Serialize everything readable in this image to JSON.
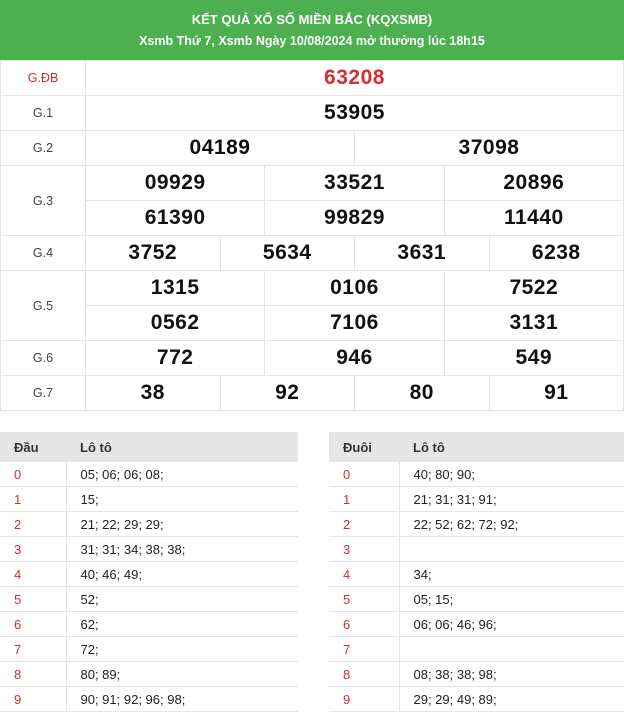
{
  "header": {
    "title": "KẾT QUẢ XỔ SỐ MIỀN BẮC (KQXSMB)",
    "subtitle": "Xsmb Thứ 7, Xsmb Ngày 10/08/2024 mở thưởng lúc 18h15"
  },
  "prizes": {
    "gdb": {
      "label": "G.ĐB",
      "values": [
        "63208"
      ]
    },
    "g1": {
      "label": "G.1",
      "values": [
        "53905"
      ]
    },
    "g2": {
      "label": "G.2",
      "values": [
        "04189",
        "37098"
      ]
    },
    "g3": {
      "label": "G.3",
      "values": [
        "09929",
        "33521",
        "20896",
        "61390",
        "99829",
        "11440"
      ]
    },
    "g4": {
      "label": "G.4",
      "values": [
        "3752",
        "5634",
        "3631",
        "6238"
      ]
    },
    "g5": {
      "label": "G.5",
      "values": [
        "1315",
        "0106",
        "7522",
        "0562",
        "7106",
        "3131"
      ]
    },
    "g6": {
      "label": "G.6",
      "values": [
        "772",
        "946",
        "549"
      ]
    },
    "g7": {
      "label": "G.7",
      "values": [
        "38",
        "92",
        "80",
        "91"
      ]
    }
  },
  "dau": {
    "h1": "Đầu",
    "h2": "Lô tô",
    "rows": [
      {
        "k": "0",
        "v": "05; 06; 06; 08;"
      },
      {
        "k": "1",
        "v": "15;"
      },
      {
        "k": "2",
        "v": "21; 22; 29; 29;"
      },
      {
        "k": "3",
        "v": "31; 31; 34; 38; 38;"
      },
      {
        "k": "4",
        "v": "40; 46; 49;"
      },
      {
        "k": "5",
        "v": "52;"
      },
      {
        "k": "6",
        "v": "62;"
      },
      {
        "k": "7",
        "v": "72;"
      },
      {
        "k": "8",
        "v": "80; 89;"
      },
      {
        "k": "9",
        "v": "90; 91; 92; 96; 98;"
      }
    ]
  },
  "duoi": {
    "h1": "Đuôi",
    "h2": "Lô tô",
    "rows": [
      {
        "k": "0",
        "v": "40; 80; 90;"
      },
      {
        "k": "1",
        "v": "21; 31; 31; 91;"
      },
      {
        "k": "2",
        "v": "22; 52; 62; 72; 92;"
      },
      {
        "k": "3",
        "v": ""
      },
      {
        "k": "4",
        "v": "34;"
      },
      {
        "k": "5",
        "v": "05; 15;"
      },
      {
        "k": "6",
        "v": "06; 06; 46; 96;"
      },
      {
        "k": "7",
        "v": ""
      },
      {
        "k": "8",
        "v": "08; 38; 38; 98;"
      },
      {
        "k": "9",
        "v": "29; 29; 49; 89;"
      }
    ]
  }
}
